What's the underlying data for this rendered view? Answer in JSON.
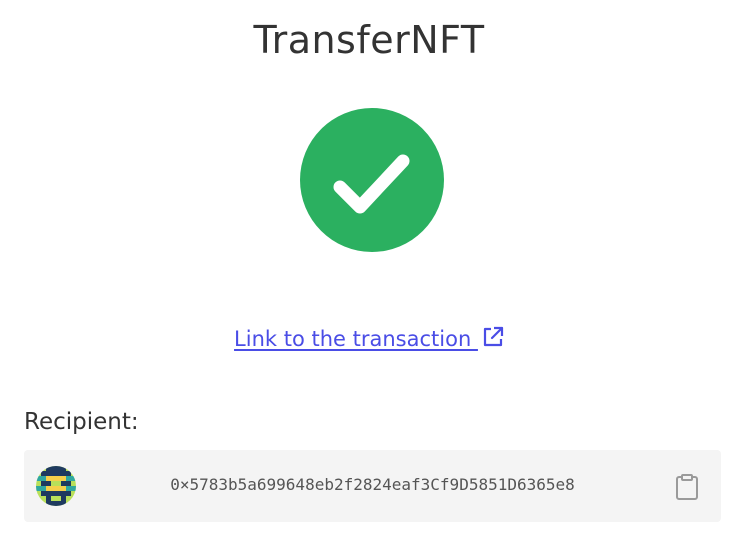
{
  "header": {
    "title": "TransferNFT"
  },
  "status": {
    "icon": "checkmark-icon",
    "color": "#2bb060"
  },
  "transaction": {
    "link_label": "Link to the transaction ",
    "link_icon": "external-link-icon",
    "link_color": "#4a4de6"
  },
  "recipient": {
    "label": "Recipient:",
    "address": "0×5783b5a699648eb2f2824eaf3Cf9D5851D6365e8",
    "avatar_icon": "identicon-avatar",
    "copy_icon": "clipboard-icon"
  }
}
